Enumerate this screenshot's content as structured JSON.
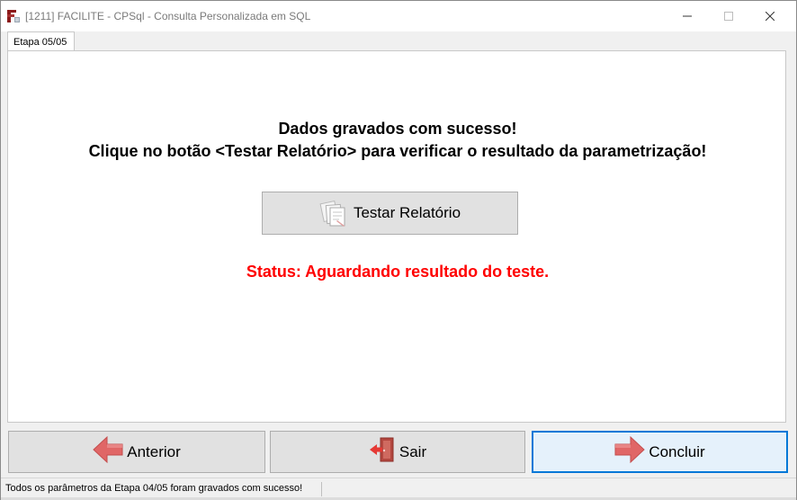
{
  "window": {
    "title": "[1211] FACILITE - CPSql - Consulta Personalizada em SQL"
  },
  "tabs": [
    {
      "label": "Etapa 05/05",
      "active": true
    }
  ],
  "main": {
    "message_line1": "Dados gravados com sucesso!",
    "message_line2": "Clique no botão <Testar Relatório> para verificar o resultado da parametrização!",
    "test_button_label": "Testar Relatório",
    "test_button_icon": "documents-icon",
    "status_text": "Status: Aguardando resultado do teste."
  },
  "footer_buttons": {
    "prev_label": "Anterior",
    "prev_icon": "arrow-left-icon",
    "exit_label": "Sair",
    "exit_icon": "exit-door-icon",
    "next_label": "Concluir",
    "next_icon": "arrow-right-icon"
  },
  "statusbar": {
    "text": "Todos os parâmetros da Etapa 04/05 foram gravados com sucesso!"
  },
  "colors": {
    "status_red": "#ff0000",
    "arrow_red": "#e06666",
    "focus_blue": "#0078d7",
    "button_face": "#e1e1e1",
    "panel_bg": "#f0f0f0"
  }
}
